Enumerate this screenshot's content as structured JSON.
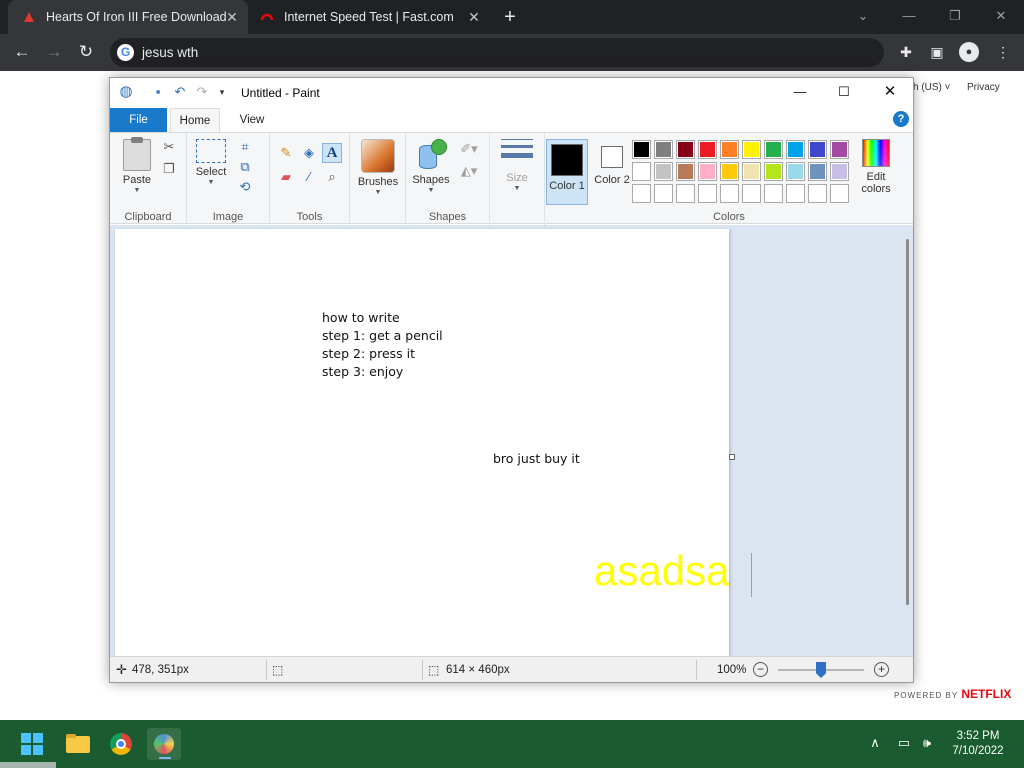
{
  "browser": {
    "tabs": [
      {
        "title": "Hearts Of Iron III Free Download",
        "active": true
      },
      {
        "title": "Internet Speed Test | Fast.com",
        "active": false
      }
    ],
    "new_tab": "+",
    "omnibox_text": "jesus wth",
    "page_text": {
      "language": "sh (US) ˅",
      "privacy": "Privacy",
      "powered_by": "POWERED BY",
      "netflix": "NETFLIX"
    }
  },
  "paint": {
    "window_title": "Untitled - Paint",
    "tabs": {
      "file": "File",
      "home": "Home",
      "view": "View"
    },
    "groups": {
      "clipboard": {
        "label": "Clipboard",
        "paste": "Paste"
      },
      "image": {
        "label": "Image",
        "select": "Select"
      },
      "tools": {
        "label": "Tools"
      },
      "brushes": "Brushes",
      "shapes": {
        "label": "Shapes",
        "button": "Shapes"
      },
      "size": "Size",
      "colors": {
        "label": "Colors",
        "color1": "Color 1",
        "color2": "Color 2",
        "edit": "Edit colors",
        "palette_row1": [
          "#000000",
          "#7f7f7f",
          "#880015",
          "#ed1c24",
          "#ff7f27",
          "#fff200",
          "#22b14c",
          "#00a2e8",
          "#3f48cc",
          "#a349a4"
        ],
        "palette_row2": [
          "#ffffff",
          "#c3c3c3",
          "#b97a57",
          "#ffaec9",
          "#ffc90e",
          "#efe4b0",
          "#b5e61d",
          "#99d9ea",
          "#7092be",
          "#c8bfe7"
        ]
      }
    },
    "canvas": {
      "block_text": "how to write\nstep 1: get a pencil\nstep 2: press it\nstep 3: enjoy",
      "mid_text": "bro just buy it",
      "big_text": "asadsa"
    },
    "status": {
      "cursor_pos": "478, 351px",
      "image_size": "614 × 460px",
      "zoom": "100%"
    }
  },
  "taskbar": {
    "time": "3:52 PM",
    "date": "7/10/2022"
  },
  "colors": {
    "accent_blue": "#1979ca",
    "taskbar_green": "#1a5c2f",
    "chrome_dark": "#202124"
  }
}
